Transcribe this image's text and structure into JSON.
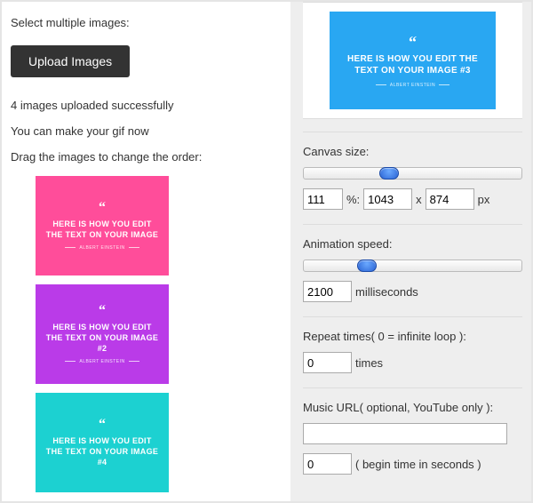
{
  "left": {
    "select_label": "Select multiple images:",
    "upload_button": "Upload Images",
    "uploaded_msg": "4 images uploaded successfully",
    "ready_msg": "You can make your gif now",
    "drag_msg": "Drag the images to change the order:",
    "quote_glyph": "“",
    "attribution": "ALBERT EINSTEIN",
    "thumb1_text": "HERE IS HOW YOU EDIT THE TEXT ON YOUR IMAGE",
    "thumb2_text": "HERE IS HOW YOU EDIT THE TEXT ON YOUR IMAGE #2",
    "thumb3_text": "HERE IS HOW YOU EDIT THE TEXT ON YOUR IMAGE #4"
  },
  "preview": {
    "quote_glyph": "“",
    "text": "HERE IS HOW YOU EDIT THE TEXT ON YOUR IMAGE #3",
    "attribution": "ALBERT EINSTEIN"
  },
  "canvas": {
    "label": "Canvas size:",
    "percent": "111",
    "percent_suffix": "%:",
    "width": "1043",
    "x": "x",
    "height": "874",
    "px": "px"
  },
  "speed": {
    "label": "Animation speed:",
    "value": "2100",
    "unit": "milliseconds"
  },
  "repeat": {
    "label": "Repeat times( 0 = infinite loop ):",
    "value": "0",
    "unit": "times"
  },
  "music": {
    "label": "Music URL( optional, YouTube only ):",
    "url": "",
    "begin": "0",
    "begin_suffix": "( begin time in seconds )"
  }
}
